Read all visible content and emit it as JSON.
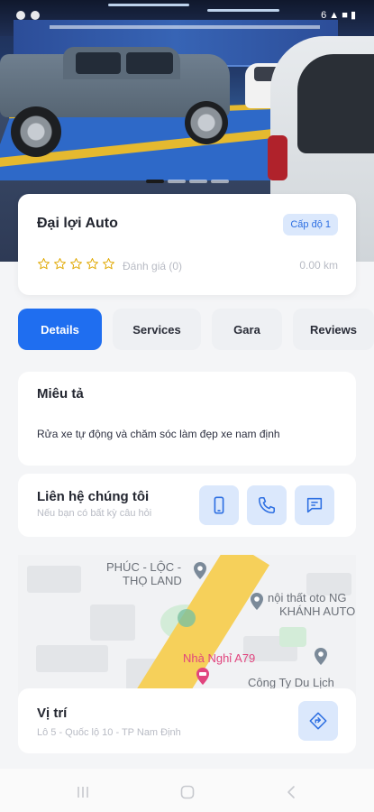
{
  "status_bar": {
    "right_text": "6 ▲ ■ ▮"
  },
  "hero": {
    "carousel_pages": 4,
    "carousel_active": 1
  },
  "shop": {
    "name": "Đại lợi Auto",
    "level": "Cấp độ 1",
    "rating_stars": 0,
    "rating_text": "Đánh giá (0)",
    "distance": "0.00 km"
  },
  "tabs": [
    {
      "label": "Details",
      "active": true
    },
    {
      "label": "Services",
      "active": false
    },
    {
      "label": "Gara",
      "active": false
    },
    {
      "label": "Reviews",
      "active": false
    }
  ],
  "description": {
    "title": "Miêu tả",
    "text": "Rửa xe tự động và chăm sóc làm đẹp xe nam định"
  },
  "contact": {
    "title": "Liên hệ chúng tôi",
    "subtitle": "Nếu bạn có bất kỳ câu hỏi",
    "buttons": [
      "mobile-icon",
      "phone-icon",
      "message-icon"
    ]
  },
  "map": {
    "labels": {
      "place1_line1": "PHÚC - LỘC -",
      "place1_line2": "THỌ LAND",
      "place2_line1": "nội thất oto NG",
      "place2_line2": "KHÁNH AUTO",
      "place3": "Nhà Nghỉ A79",
      "place4": "Công Ty Du Lịch"
    }
  },
  "location": {
    "title": "Vị trí",
    "address": "Lô 5 - Quốc lộ 10 - TP Nam Định"
  },
  "colors": {
    "primary": "#1f6ef0",
    "badge_bg": "#dbe8fc",
    "muted_text": "#b8bbc4"
  }
}
